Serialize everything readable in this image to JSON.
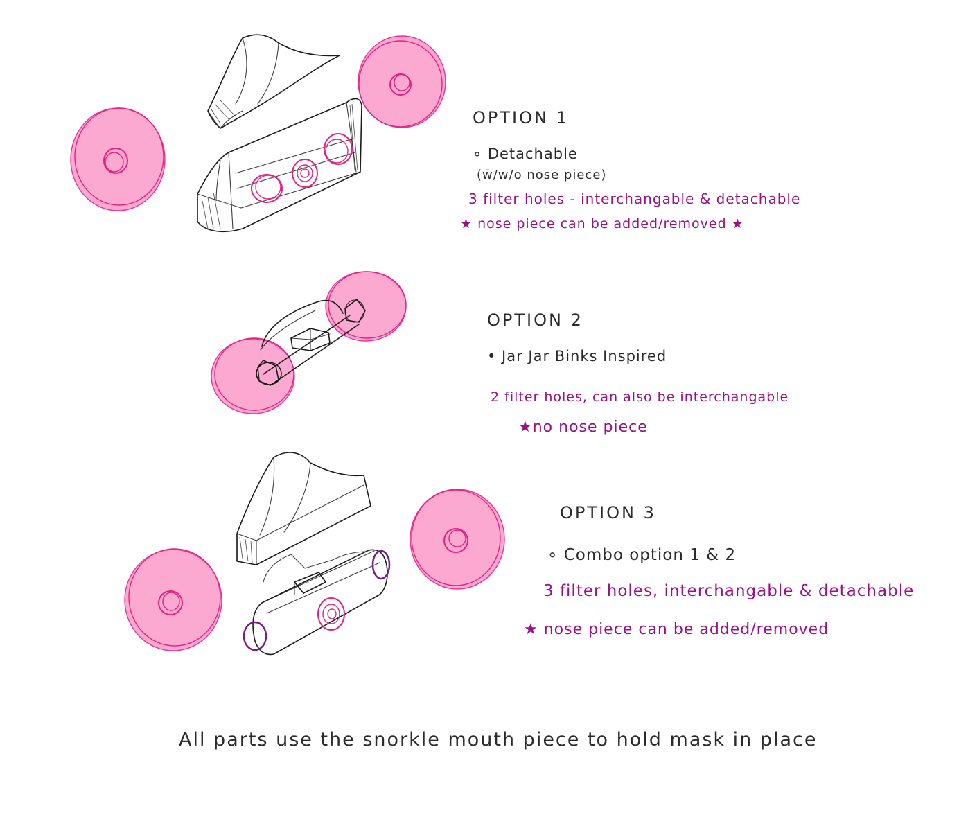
{
  "options": [
    {
      "title": "OPTION 1",
      "feature": "∘ Detachable",
      "feature_detail": "(w̄/w/o nose piece)",
      "filters": "3 filter holes - interchangable & detachable",
      "note": "★ nose piece can be added/removed ★"
    },
    {
      "title": "OPTION 2",
      "feature": "• Jar Jar Binks Inspired",
      "filters": "2 filter holes, can also be interchangable",
      "note": "★no nose piece"
    },
    {
      "title": "OPTION 3",
      "feature": "∘ Combo option 1 & 2",
      "filters": "3 filter holes, interchangable & detachable",
      "note": "★ nose piece can be added/removed"
    }
  ],
  "footer": "All parts use the snorkle mouth piece to hold mask in place",
  "colors": {
    "filter_pink": "#fba9d1",
    "filter_outline": "#f02f94",
    "annotation_magenta": "#9c0f86",
    "pencil": "#1a1a1a"
  }
}
